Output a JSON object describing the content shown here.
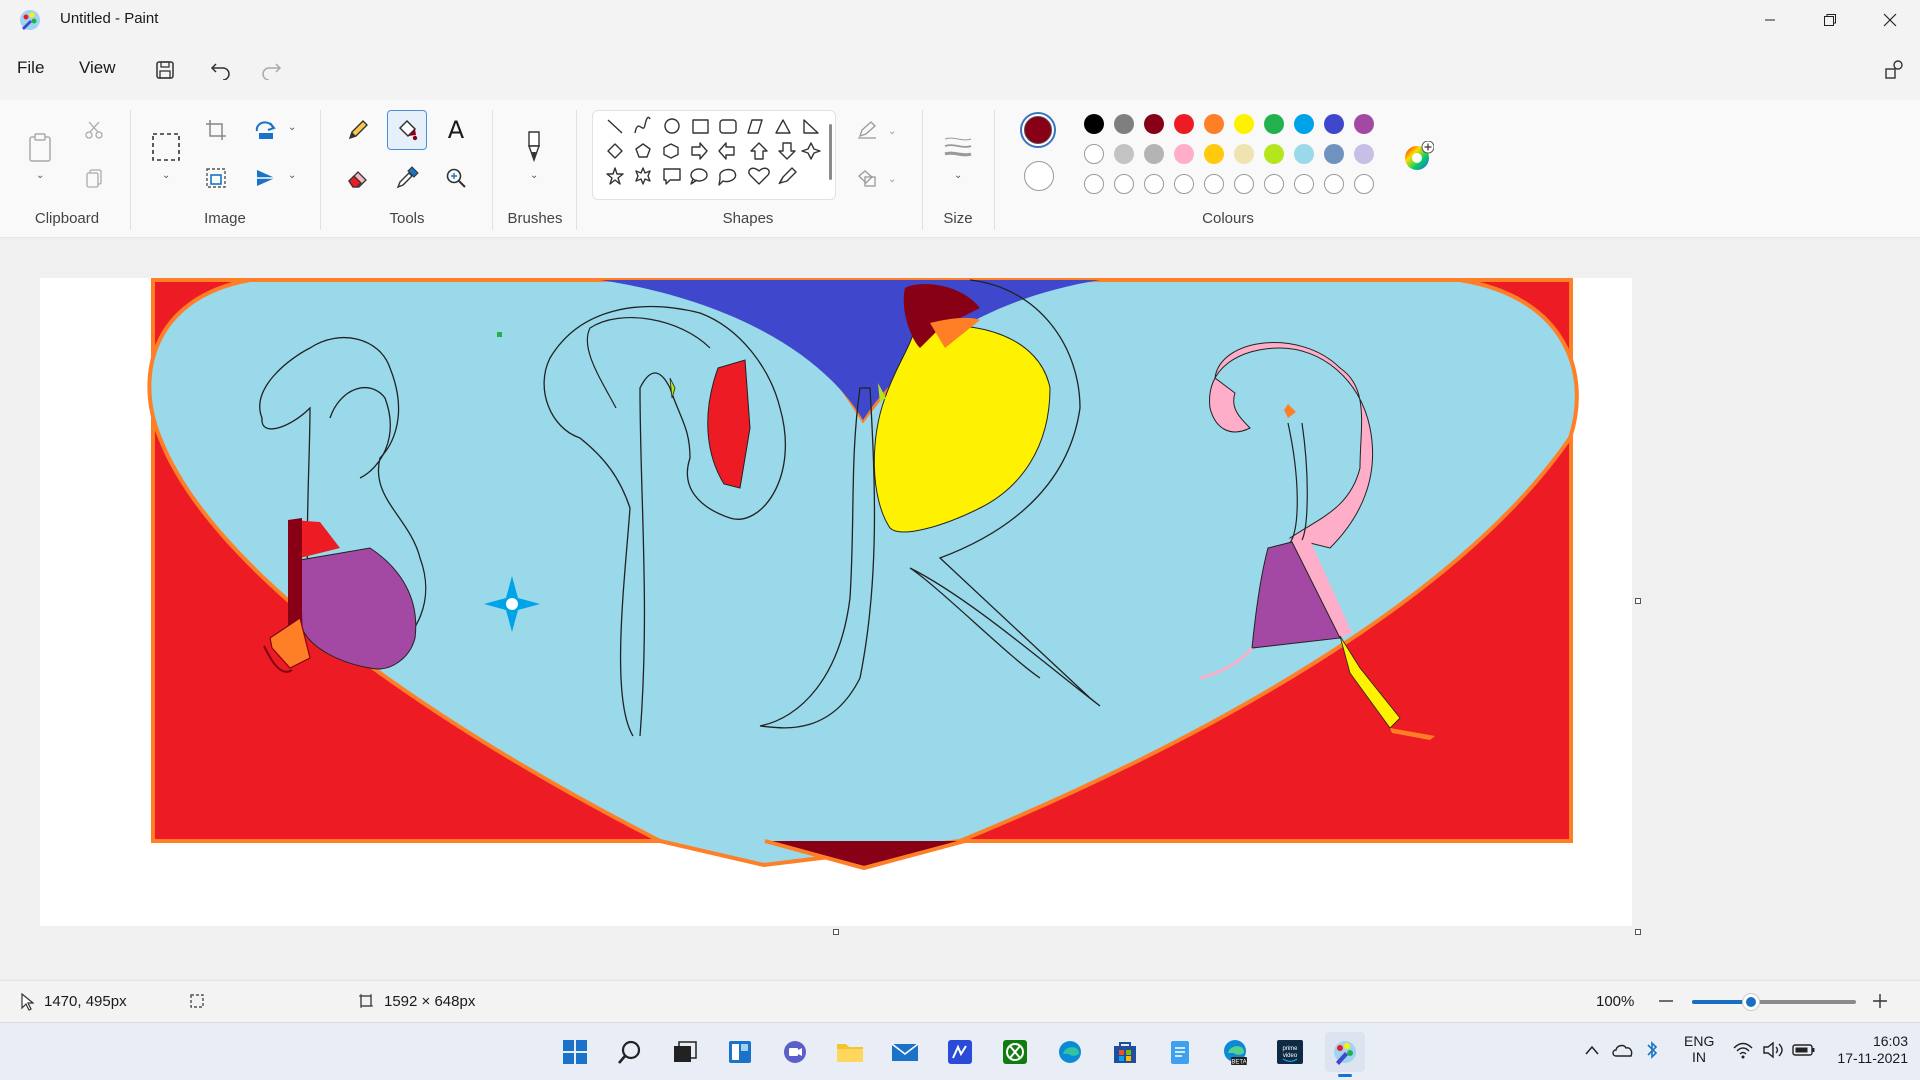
{
  "window": {
    "title": "Untitled - Paint"
  },
  "menu": {
    "file": "File",
    "view": "View"
  },
  "ribbon": {
    "groups": {
      "clipboard": "Clipboard",
      "image": "Image",
      "tools": "Tools",
      "brushes": "Brushes",
      "shapes": "Shapes",
      "size": "Size",
      "colours": "Colours"
    },
    "text_tool_glyph": "A",
    "selected_tool": "fill-tool",
    "primary_color": "#880015",
    "secondary_color": "#ffffff",
    "palette_row1": [
      "#000000",
      "#7f7f7f",
      "#880015",
      "#ed1c24",
      "#ff7f27",
      "#fff200",
      "#22b14c",
      "#00a2e8",
      "#3f48cc",
      "#a349a4"
    ],
    "palette_row2": [
      "#ffffff",
      "#c3c3c3",
      "#b4b4b4",
      "#ffaec9",
      "#ffc90e",
      "#efe4b0",
      "#b5e61d",
      "#99d9ea",
      "#7092be",
      "#c8bfe7"
    ]
  },
  "status": {
    "cursor_pos": "1470, 495px",
    "canvas_size": "1592 × 648px",
    "zoom": "100%",
    "zoom_level": 1.0
  },
  "tray": {
    "lang_line1": "ENG",
    "lang_line2": "IN",
    "time": "16:03",
    "date": "17-11-2021"
  }
}
